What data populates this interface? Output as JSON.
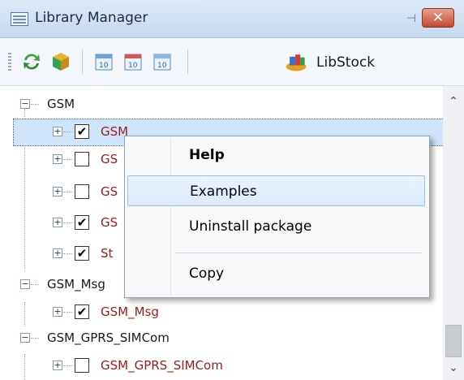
{
  "window": {
    "title": "Library Manager"
  },
  "toolbar": {
    "libstock_label": "LibStock"
  },
  "tree": {
    "rows": [
      {
        "label": "GSM",
        "kind": "group"
      },
      {
        "label": "GSM",
        "kind": "package",
        "checked": true,
        "selected": true
      },
      {
        "label": "GS",
        "kind": "package",
        "checked": false
      },
      {
        "label": "GS",
        "kind": "package",
        "checked": false
      },
      {
        "label": "GS",
        "kind": "package",
        "checked": true
      },
      {
        "label": "St",
        "kind": "package",
        "checked": true
      },
      {
        "label": "GSM_Msg",
        "kind": "group"
      },
      {
        "label": "GSM_Msg",
        "kind": "package",
        "checked": true
      },
      {
        "label": "GSM_GPRS_SIMCom",
        "kind": "group"
      },
      {
        "label": "GSM_GPRS_SIMCom",
        "kind": "package",
        "checked": false
      }
    ]
  },
  "context_menu": {
    "help": "Help",
    "examples": "Examples",
    "uninstall": "Uninstall package",
    "copy": "Copy"
  },
  "glyphs": {
    "check": "✔",
    "minus": "−",
    "plus": "+",
    "close": "✕",
    "pin": "⊣",
    "up": "⌃",
    "down": "⌄"
  },
  "colors": {
    "package_text": "#9c1a1a",
    "selection": "#cfe4fb"
  }
}
